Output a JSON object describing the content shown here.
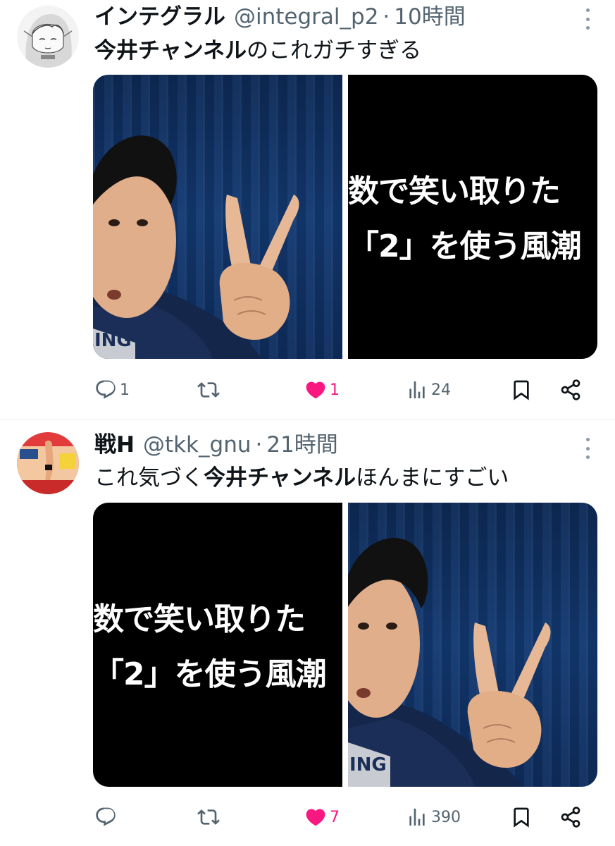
{
  "tweets": [
    {
      "name": "インテグラル",
      "handle": "@integral_p2",
      "separator": "·",
      "time": "10時間",
      "text_bold": "今井チャンネル",
      "text_rest": "のこれガチすぎる",
      "media_caption_line1": "数で笑い取りた",
      "media_caption_line2": "「2」を使う風潮",
      "reply_count": "1",
      "retweet_count": "",
      "like_count": "1",
      "view_count": "24",
      "icons": [
        "reply-icon",
        "retweet-icon",
        "like-icon-filled",
        "views-icon",
        "bookmark-icon",
        "share-icon"
      ]
    },
    {
      "name": "戦H",
      "handle": "@tkk_gnu",
      "separator": "·",
      "time": "21時間",
      "text_pre": "これ気づく",
      "text_bold": "今井チャンネル",
      "text_rest": "ほんまにすごい",
      "media_caption_line1": "数で笑い取りた",
      "media_caption_line2": "「2」を使う風潮",
      "reply_count": "",
      "retweet_count": "",
      "like_count": "7",
      "view_count": "390",
      "icons": [
        "reply-icon",
        "retweet-icon",
        "like-icon-filled",
        "views-icon",
        "bookmark-icon",
        "share-icon"
      ]
    }
  ],
  "colors": {
    "text_primary": "#0f1419",
    "text_secondary": "#536471",
    "like_pink": "#f91880",
    "divider": "#eff3f4"
  }
}
